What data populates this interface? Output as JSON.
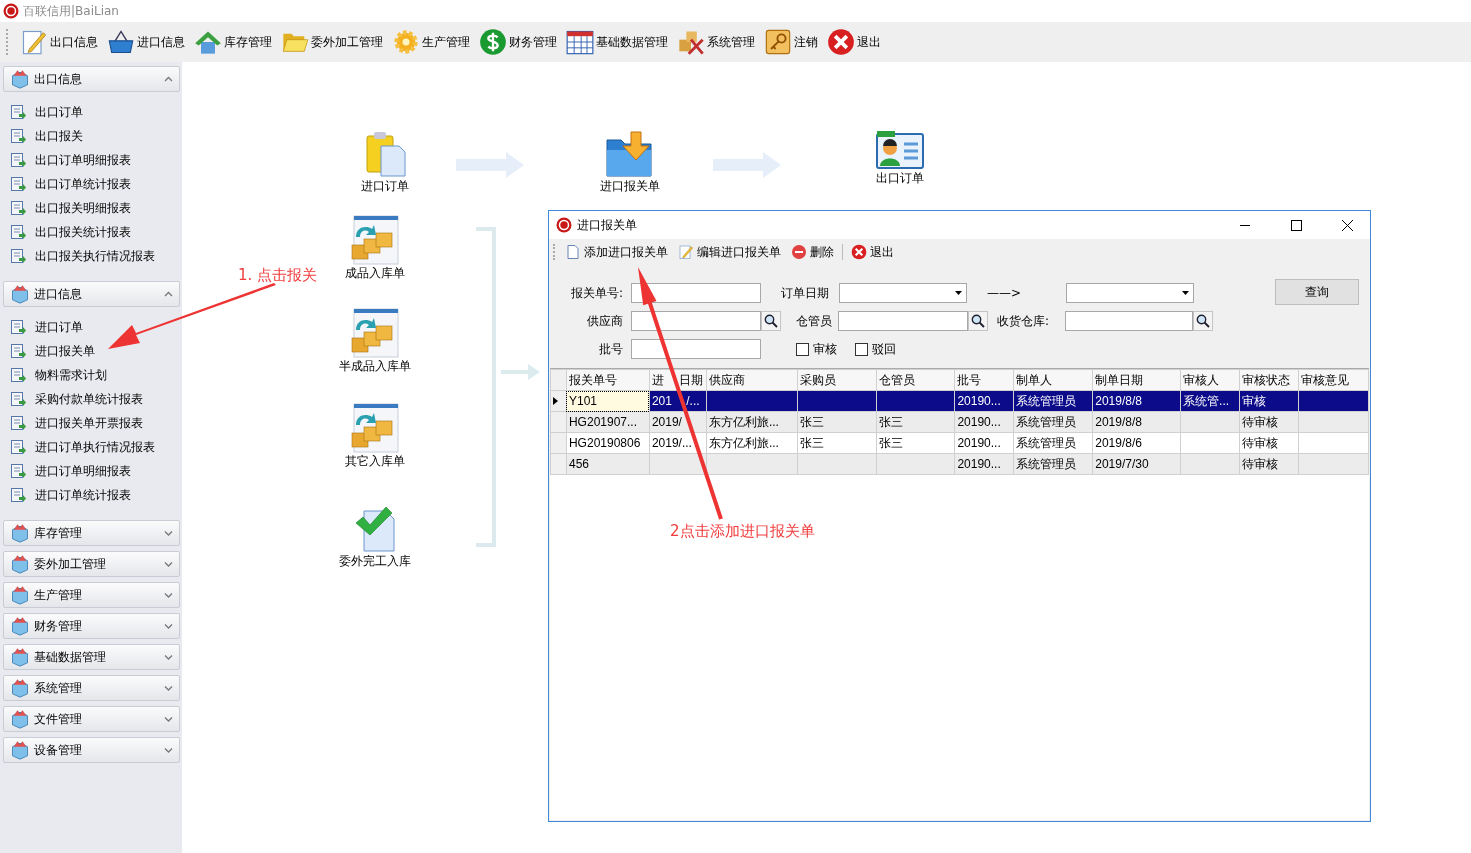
{
  "app": {
    "title": "百联信用|BaiLian"
  },
  "toolbar": [
    {
      "label": "出口信息"
    },
    {
      "label": "进口信息"
    },
    {
      "label": "库存管理"
    },
    {
      "label": "委外加工管理"
    },
    {
      "label": "生产管理"
    },
    {
      "label": "财务管理"
    },
    {
      "label": "基础数据管理"
    },
    {
      "label": "系统管理"
    },
    {
      "label": "注销"
    },
    {
      "label": "退出"
    }
  ],
  "sidebar": {
    "groups": [
      {
        "label": "出口信息",
        "expanded": true,
        "items": [
          "出口订单",
          "出口报关",
          "出口订单明细报表",
          "出口订单统计报表",
          "出口报关明细报表",
          "出口报关统计报表",
          "出口报关执行情况报表"
        ]
      },
      {
        "label": "进口信息",
        "expanded": true,
        "items": [
          "进口订单",
          "进口报关单",
          "物料需求计划",
          "采购付款单统计报表",
          "进口报关单开票报表",
          "进口订单执行情况报表",
          "进口订单明细报表",
          "进口订单统计报表"
        ]
      },
      {
        "label": "库存管理",
        "expanded": false
      },
      {
        "label": "委外加工管理",
        "expanded": false
      },
      {
        "label": "生产管理",
        "expanded": false
      },
      {
        "label": "财务管理",
        "expanded": false
      },
      {
        "label": "基础数据管理",
        "expanded": false
      },
      {
        "label": "系统管理",
        "expanded": false
      },
      {
        "label": "文件管理",
        "expanded": false
      },
      {
        "label": "设备管理",
        "expanded": false
      }
    ]
  },
  "flow": {
    "nodes": [
      {
        "label": "进口订单"
      },
      {
        "label": "进口报关单"
      },
      {
        "label": "出口订单"
      },
      {
        "label": "成品入库单"
      },
      {
        "label": "半成品入库单"
      },
      {
        "label": "其它入库单"
      },
      {
        "label": "委外完工入库"
      }
    ]
  },
  "window": {
    "title": "进口报关单",
    "toolbar": [
      {
        "label": "添加进口报关单"
      },
      {
        "label": "编辑进口报关单"
      },
      {
        "label": "删除"
      },
      {
        "label": "退出"
      }
    ],
    "filters": {
      "declaration_no": "报关单号:",
      "order_date": "订单日期",
      "range_arrow": "——>",
      "query_button": "查询",
      "supplier": "供应商",
      "keeper": "仓管员",
      "warehouse": "收货仓库:",
      "batch": "批号",
      "checkboxes": [
        {
          "label": "审核",
          "checked": false
        },
        {
          "label": "驳回",
          "checked": false
        }
      ]
    },
    "table": {
      "columns": [
        "报关单号",
        "进 日期",
        "供应商",
        "采购员",
        "仓管员",
        "批号",
        "制单人",
        "制单日期",
        "审核人",
        "审核状态",
        "审核意见"
      ],
      "rows": [
        {
          "selected": true,
          "cells": [
            "Y101",
            "201 /...",
            "",
            "",
            "",
            "20190...",
            "系统管理员",
            "2019/8/8",
            "系统管...",
            "审核",
            ""
          ]
        },
        {
          "selected": false,
          "cells": [
            "HG201907...",
            "2019/",
            "东方亿利旅...",
            "张三",
            "张三",
            "20190...",
            "系统管理员",
            "2019/8/8",
            "",
            "待审核",
            ""
          ]
        },
        {
          "selected": false,
          "cells": [
            "HG20190806",
            "2019/...",
            "东方亿利旅...",
            "张三",
            "张三",
            "20190...",
            "系统管理员",
            "2019/8/6",
            "",
            "待审核",
            ""
          ]
        },
        {
          "selected": false,
          "cells": [
            "456",
            "",
            "",
            "",
            "",
            "20190...",
            "系统管理员",
            "2019/7/30",
            "",
            "待审核",
            ""
          ]
        }
      ]
    }
  },
  "annotations": [
    {
      "text": "1. 点击报关"
    },
    {
      "text": "2点击添加进口报关单"
    }
  ]
}
